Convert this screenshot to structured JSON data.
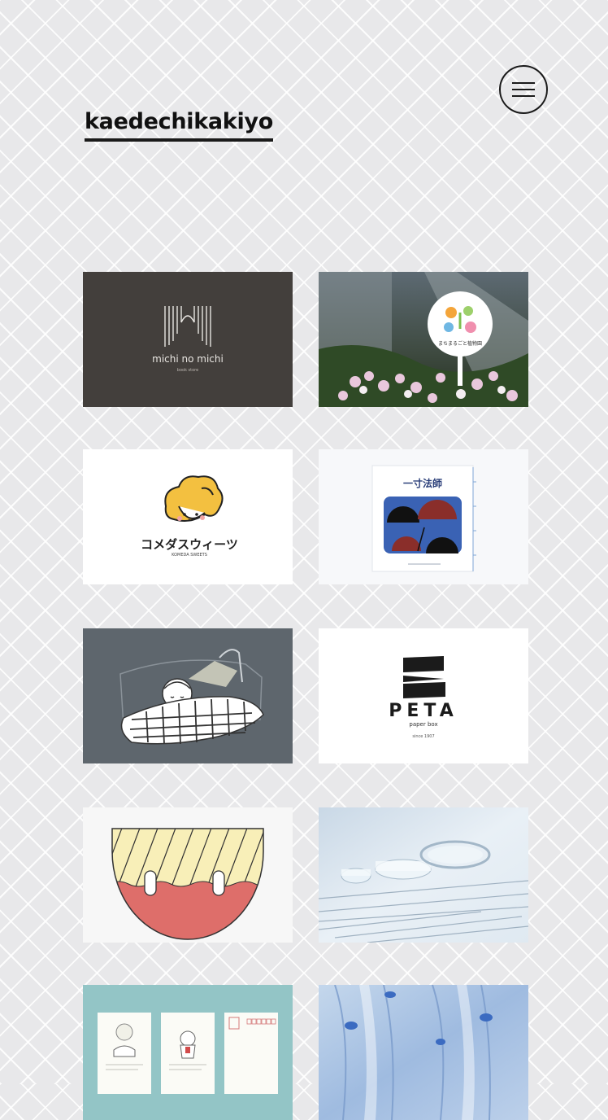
{
  "site": {
    "title": "kaedechikakiyo"
  },
  "header": {
    "menu_icon": "hamburger-menu-icon"
  },
  "works": [
    {
      "title": "michi no michi",
      "subtitle": "book store"
    },
    {
      "title": "まちまるごと植物園"
    },
    {
      "title": "コメダスウィーツ",
      "subtitle": "KOMEDA SWEETS"
    },
    {
      "title": "一寸法師"
    },
    {
      "title": ""
    },
    {
      "title": "PETA",
      "subtitle": "paper box",
      "note": "since 1907"
    },
    {
      "title": ""
    },
    {
      "title": ""
    },
    {
      "title": ""
    },
    {
      "title": ""
    }
  ],
  "colors": {
    "background": "#e8e8ea",
    "text": "#111111",
    "card1_bg": "#433f3c",
    "card5_bg": "#5e666d",
    "card9_bg": "#93c5c6"
  }
}
